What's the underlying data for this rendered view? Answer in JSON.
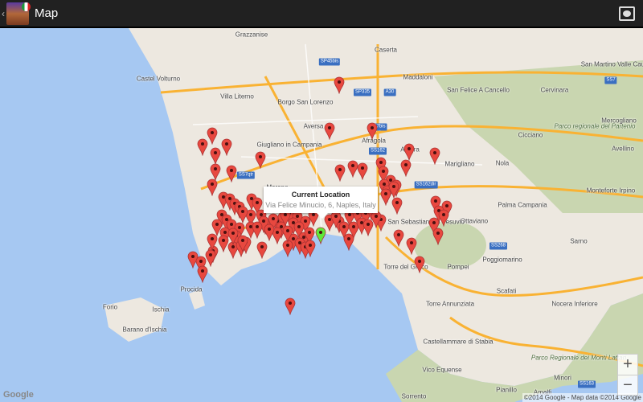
{
  "app_bar": {
    "back_icon": "chevron-left",
    "title": "Map",
    "app_icon": "colosseum-italy-flag",
    "layers_icon": "map-layers-icon"
  },
  "info_window": {
    "title": "Current Location",
    "address": "Via Felice Minucio, 6, Naples, Italy"
  },
  "labels": [
    "Grazzanise",
    "Caserta",
    "SP45bis",
    "Maddaloni",
    "San Felice A Cancello",
    "Castel Volturno",
    "Villa Literno",
    "Borgo San Lorenzo",
    "SP335",
    "Aversa",
    "Cervinara",
    "Parco regionale del Partenio",
    "Acerra",
    "Marigliano",
    "Nola",
    "Cicciano",
    "Giugliano in Campania",
    "Marano",
    "Afragola",
    "SS7bis",
    "SS162",
    "SS162dir",
    "SS7qtr",
    "Palma Campania",
    "Monteforte Irpino",
    "Ottaviano",
    "San Sebastiano Al Vesuvio",
    "Torre del Greco",
    "Pompei",
    "Torre Annunziata",
    "Scafati",
    "Nocera Inferiore",
    "Poggiomarino",
    "Sarno",
    "Ischia",
    "Forio",
    "Barano d'Ischia",
    "Procida",
    "Castellammare di Stabia",
    "Vico Equense",
    "Sorrento",
    "Pianillo",
    "Amalfi",
    "Minori",
    "Parco Regionale dei Monti Lattari",
    "SS163",
    "SS268",
    "A30",
    "SS7",
    "San Martino Valle Caudina",
    "Mercogliano",
    "Avellino"
  ],
  "zoom": {
    "in": "+",
    "out": "−"
  },
  "attribution": {
    "logo": "Google",
    "copyright": "©2014 Google - Map data ©2014 Google"
  },
  "colors": {
    "sea": "#a6c8f2",
    "land": "#ede8e0",
    "hills": "#c9d6b0",
    "road": "#f9b233",
    "pin": "#e8483f",
    "current_pin": "#5ee83a"
  }
}
